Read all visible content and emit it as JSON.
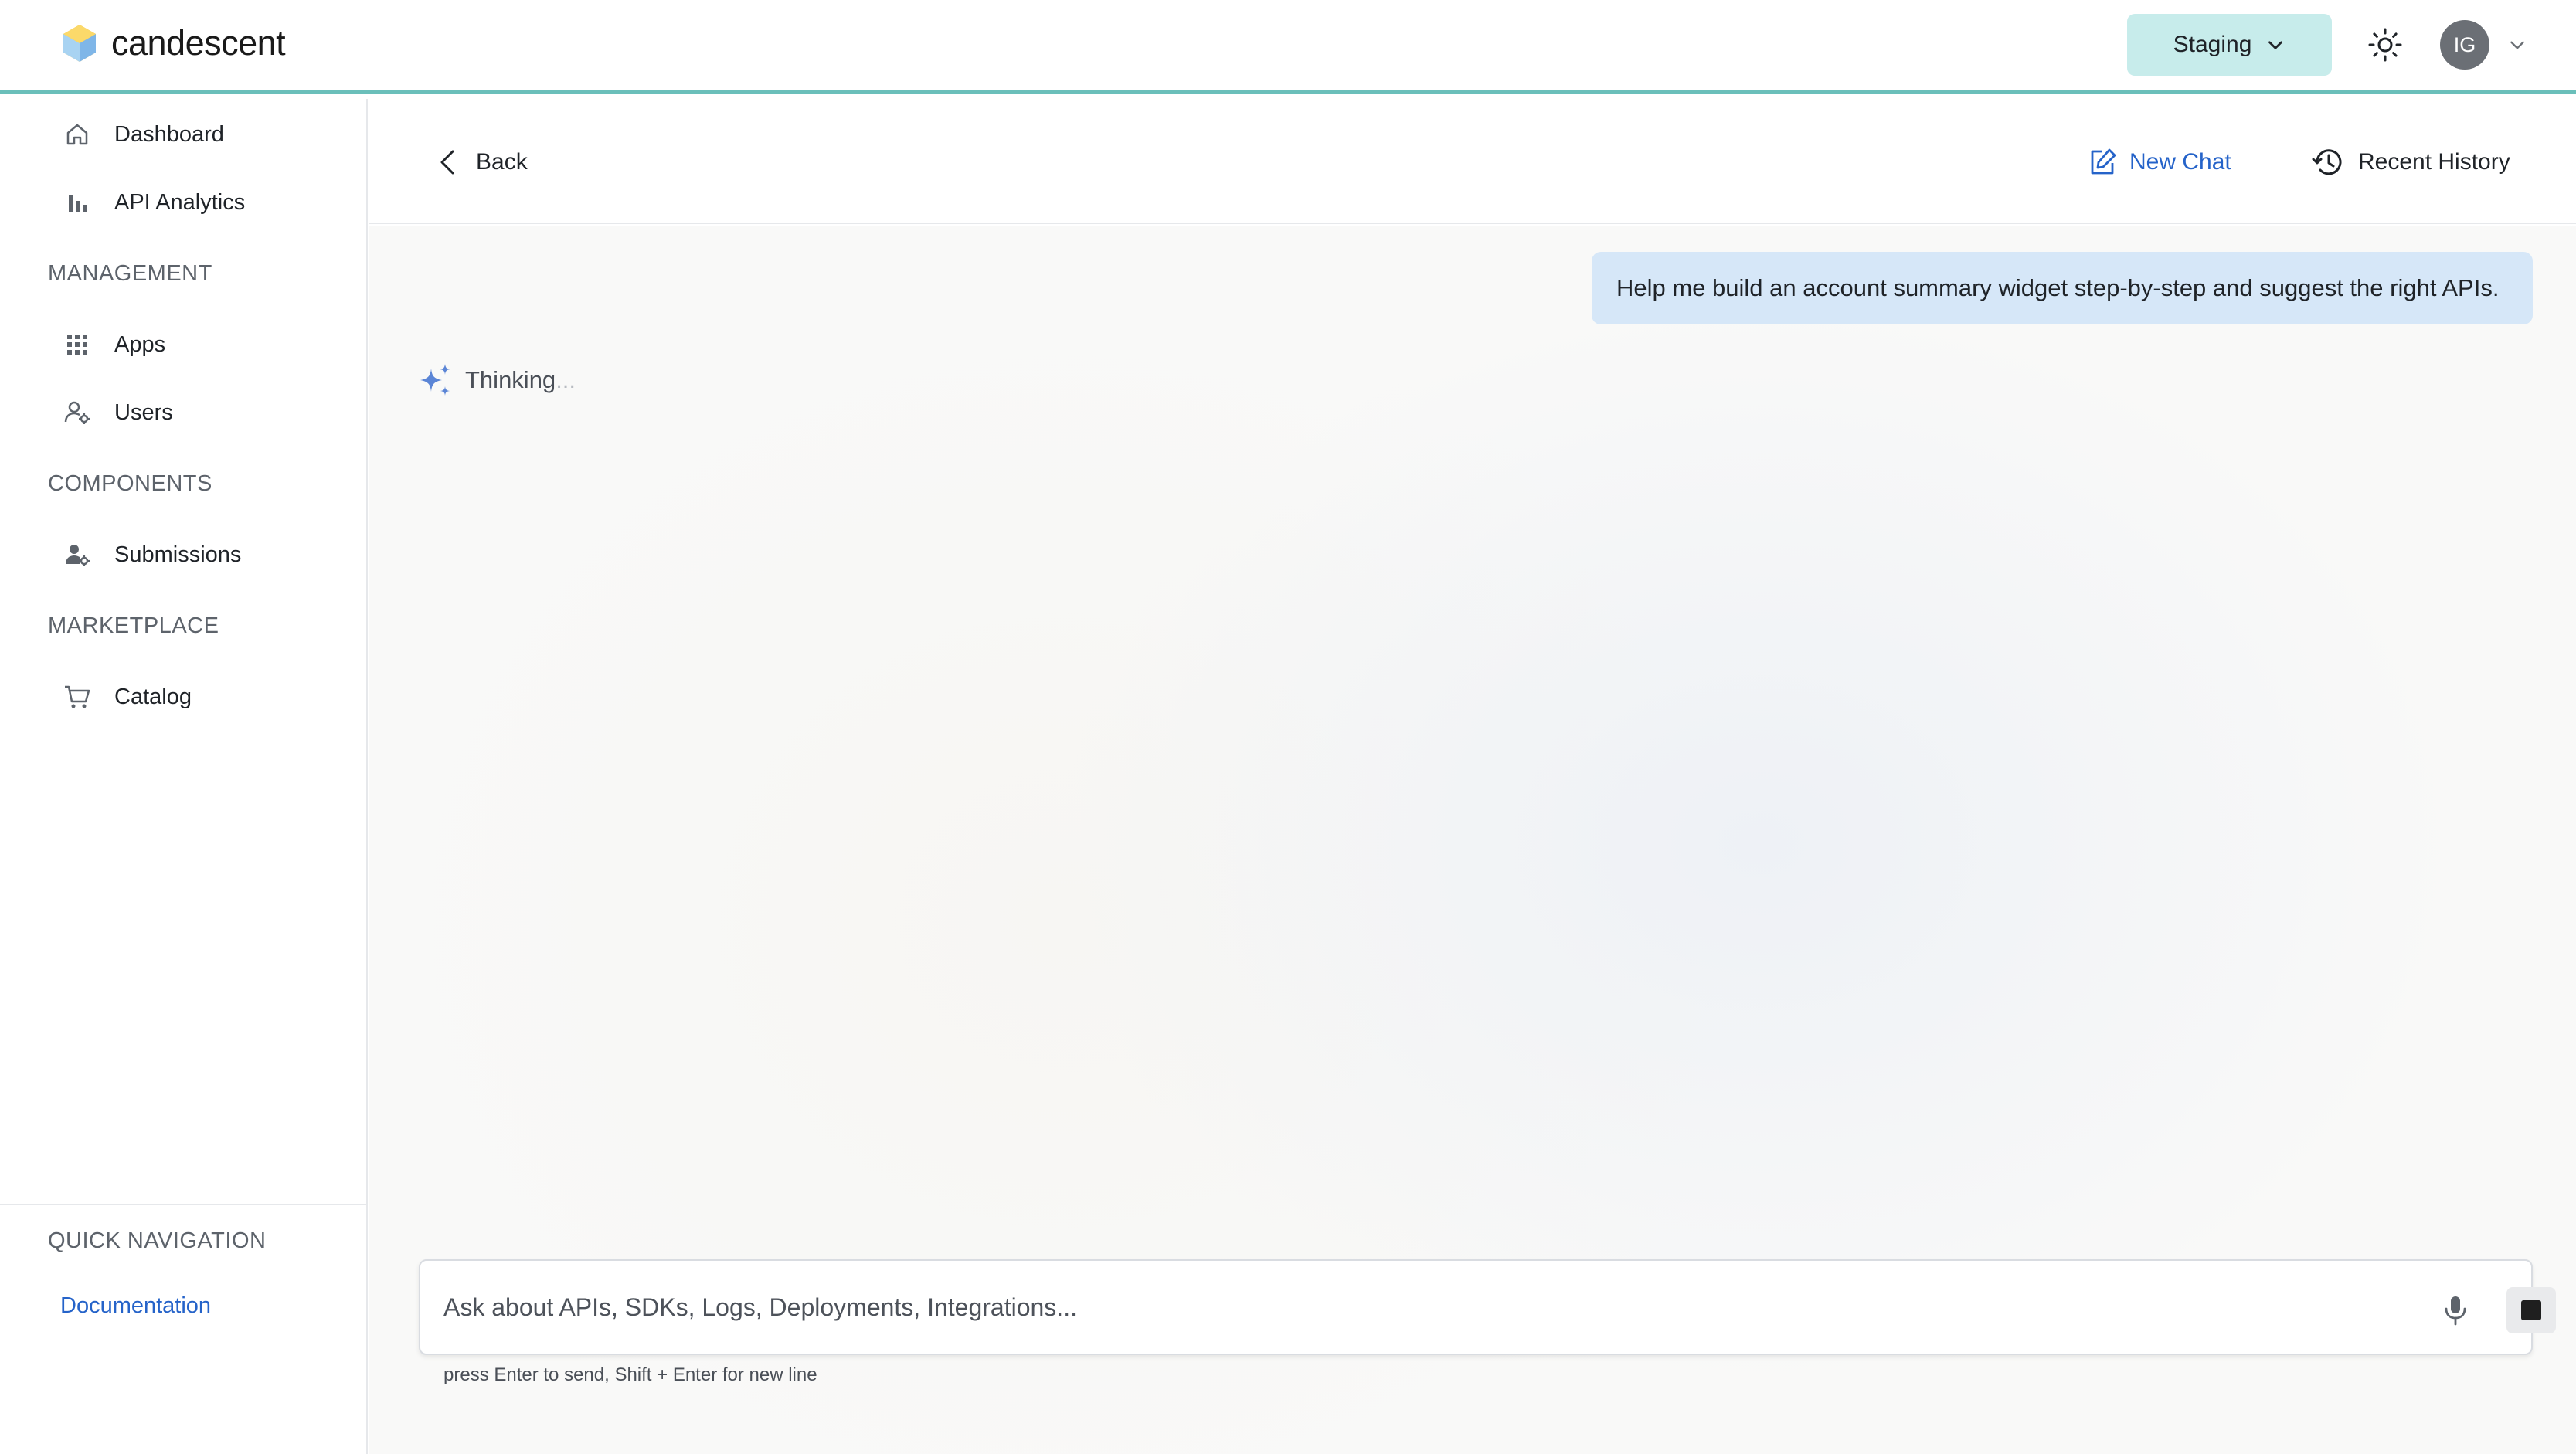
{
  "app": {
    "brand": "candescent",
    "environment": "Staging",
    "user_initials": "IG",
    "accent_color": "#6bbfba"
  },
  "sidebar": {
    "top_items": [
      {
        "label": "Dashboard",
        "icon": "home-icon"
      },
      {
        "label": "API Analytics",
        "icon": "bar-chart-icon"
      }
    ],
    "sections": [
      {
        "title": "MANAGEMENT",
        "items": [
          {
            "label": "Apps",
            "icon": "grid-icon"
          },
          {
            "label": "Users",
            "icon": "user-gear-icon"
          }
        ]
      },
      {
        "title": "COMPONENTS",
        "items": [
          {
            "label": "Submissions",
            "icon": "user-settings-icon"
          }
        ]
      },
      {
        "title": "MARKETPLACE",
        "items": [
          {
            "label": "Catalog",
            "icon": "cart-icon"
          }
        ]
      }
    ],
    "quick_nav": {
      "title": "QUICK NAVIGATION",
      "link": "Documentation"
    }
  },
  "header": {
    "back_label": "Back",
    "new_chat_label": "New Chat",
    "recent_history_label": "Recent History"
  },
  "chat": {
    "user_message": "Help me build an account summary widget step-by-step and suggest the right APIs.",
    "status": "Thinking",
    "status_dots": "..."
  },
  "composer": {
    "placeholder": "Ask about APIs, SDKs, Logs, Deployments, Integrations...",
    "value": "",
    "hint": "press Enter to send, Shift + Enter for new line"
  }
}
